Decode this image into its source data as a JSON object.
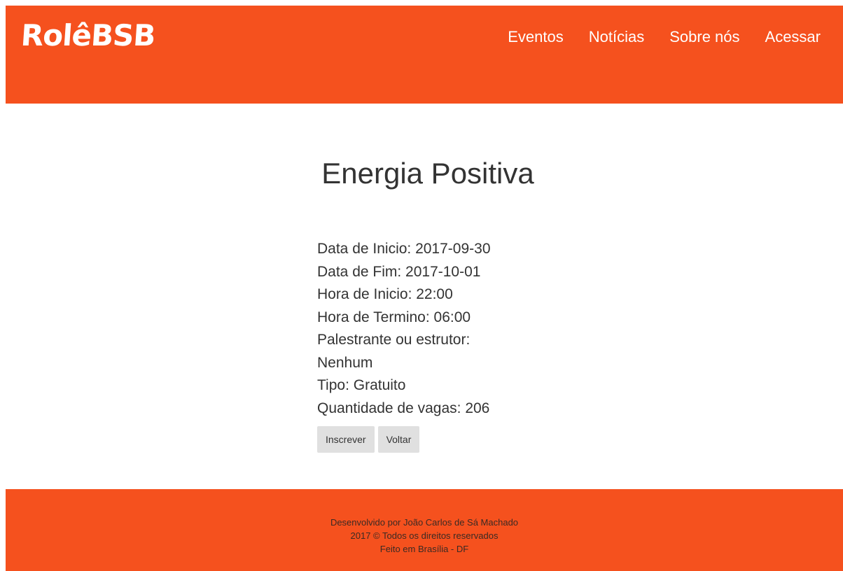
{
  "header": {
    "logo": "RolêBSB",
    "nav": [
      "Eventos",
      "Notícias",
      "Sobre nós",
      "Acessar"
    ]
  },
  "event": {
    "title": "Energia Positiva",
    "details": [
      "Data de Inicio: 2017-09-30",
      "Data de Fim: 2017-10-01",
      "Hora de Inicio: 22:00",
      "Hora de Termino: 06:00",
      "Palestrante ou estrutor:",
      "Nenhum",
      "Tipo: Gratuito",
      "Quantidade de vagas: 206"
    ],
    "buttons": {
      "subscribe": "Inscrever",
      "back": "Voltar"
    }
  },
  "footer": {
    "lines": [
      "Desenvolvido por João Carlos de Sá Machado",
      "2017 © Todos os direitos reservados",
      "Feito em Brasília - DF"
    ]
  },
  "colors": {
    "brand": "#f5511e",
    "button": "#e0e0e0",
    "text": "#333333"
  }
}
